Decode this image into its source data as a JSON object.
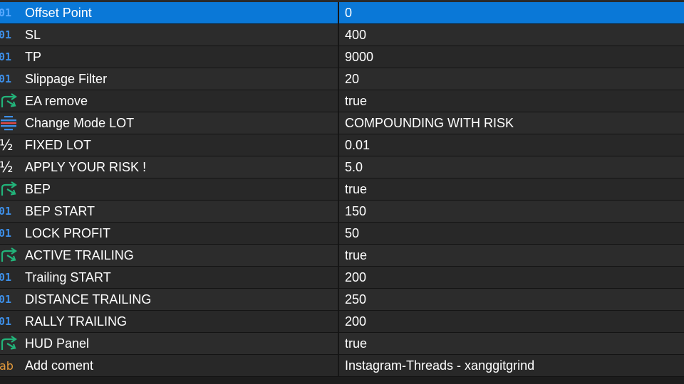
{
  "colors": {
    "selected_row": "#0a78d7",
    "row_bg": "#282828",
    "int_icon": "#3d8fe8",
    "bool_icon": "#22b47a",
    "enum_icon": "#3d8fe8",
    "string_icon": "#e39a3c"
  },
  "params": [
    {
      "name": "Offset Point",
      "value": "0",
      "icon": "int-icon",
      "glyph": "01",
      "selected": true
    },
    {
      "name": "SL",
      "value": "400",
      "icon": "int-icon",
      "glyph": "01"
    },
    {
      "name": "TP",
      "value": "9000",
      "icon": "int-icon",
      "glyph": "01"
    },
    {
      "name": "Slippage Filter",
      "value": "20",
      "icon": "int-icon",
      "glyph": "01"
    },
    {
      "name": "EA remove",
      "value": "true",
      "icon": "bool-icon"
    },
    {
      "name": "Change Mode LOT",
      "value": "COMPOUNDING WITH RISK",
      "icon": "enum-icon"
    },
    {
      "name": "FIXED LOT",
      "value": "0.01",
      "icon": "double-icon",
      "glyph": "½"
    },
    {
      "name": "APPLY YOUR RISK !",
      "value": "5.0",
      "icon": "double-icon",
      "glyph": "½"
    },
    {
      "name": "BEP",
      "value": "true",
      "icon": "bool-icon"
    },
    {
      "name": "BEP START",
      "value": "150",
      "icon": "int-icon",
      "glyph": "01"
    },
    {
      "name": "LOCK PROFIT",
      "value": "50",
      "icon": "int-icon",
      "glyph": "01"
    },
    {
      "name": "ACTIVE TRAILING",
      "value": "true",
      "icon": "bool-icon"
    },
    {
      "name": "Trailing START",
      "value": "200",
      "icon": "int-icon",
      "glyph": "01"
    },
    {
      "name": "DISTANCE TRAILING",
      "value": "250",
      "icon": "int-icon",
      "glyph": "01"
    },
    {
      "name": "RALLY TRAILING",
      "value": "200",
      "icon": "int-icon",
      "glyph": "01"
    },
    {
      "name": "HUD Panel",
      "value": "true",
      "icon": "bool-icon"
    },
    {
      "name": "Add coment",
      "value": "Instagram-Threads - xanggitgrind",
      "icon": "string-icon",
      "glyph": "ab"
    }
  ]
}
